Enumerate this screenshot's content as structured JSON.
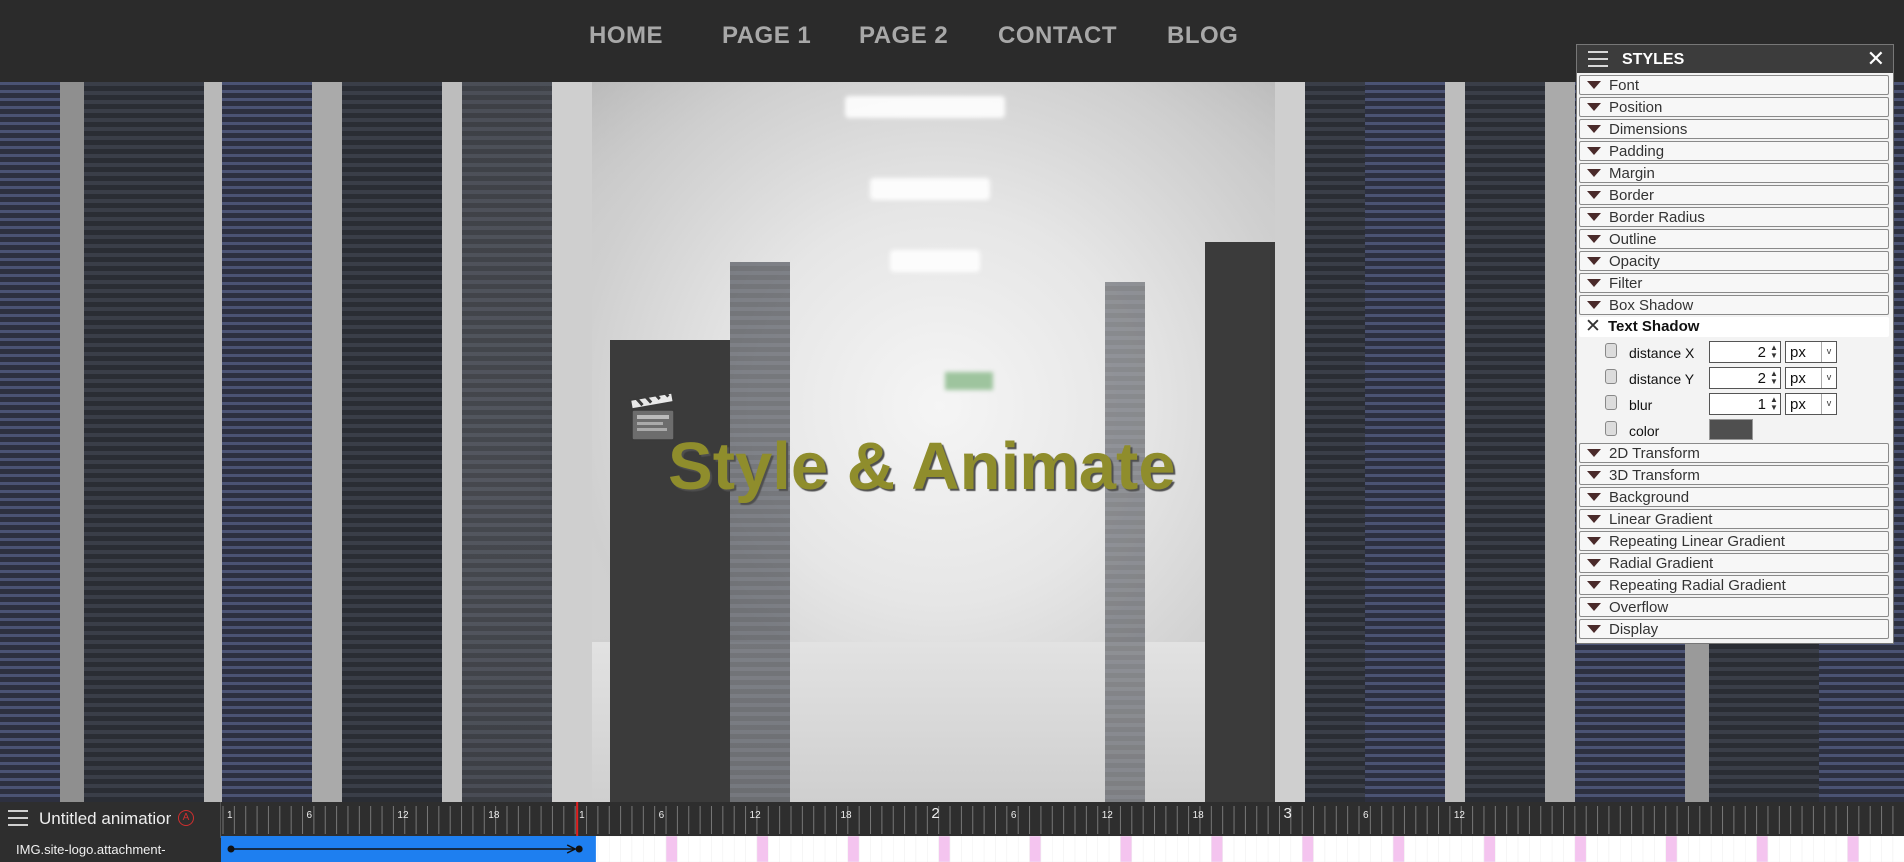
{
  "nav": {
    "items": [
      "HOME",
      "PAGE 1",
      "PAGE 2",
      "CONTACT",
      "BLOG"
    ]
  },
  "hero": {
    "title": "Style & Animate",
    "logo_icon": "clapperboard-icon"
  },
  "styles_panel": {
    "title": "STYLES",
    "sections_top": [
      "Font",
      "Position",
      "Dimensions",
      "Padding",
      "Margin",
      "Border",
      "Border Radius",
      "Outline",
      "Opacity",
      "Filter",
      "Box Shadow"
    ],
    "open_section": "Text Shadow",
    "properties": [
      {
        "label": "distance X",
        "value": "2",
        "unit": "px"
      },
      {
        "label": "distance Y",
        "value": "2",
        "unit": "px"
      },
      {
        "label": "blur",
        "value": "1",
        "unit": "px"
      },
      {
        "label": "color",
        "color": "#4f4f4f"
      }
    ],
    "sections_bottom": [
      "2D Transform",
      "3D Transform",
      "Background",
      "Linear Gradient",
      "Repeating Linear Gradient",
      "Radial Gradient",
      "Repeating Radial Gradient",
      "Overflow",
      "Display"
    ]
  },
  "timeline": {
    "animation_name": "Untitled animation",
    "layer_name": "IMG.site-logo.attachment-",
    "ruler_labels": [
      "1",
      "6",
      "12",
      "18",
      "1",
      "6",
      "12",
      "18",
      "2",
      "6",
      "12",
      "18",
      "3",
      "6",
      "12"
    ],
    "playhead_second": 1,
    "selection_color": "#1e7ff0",
    "keyframe_tint": "#f4c4ef"
  },
  "colors": {
    "nav_bg": "#2b2b2b",
    "nav_text": "#a8a8a8",
    "title": "#8f8d2c",
    "panel_header": "#3c3c3c"
  }
}
